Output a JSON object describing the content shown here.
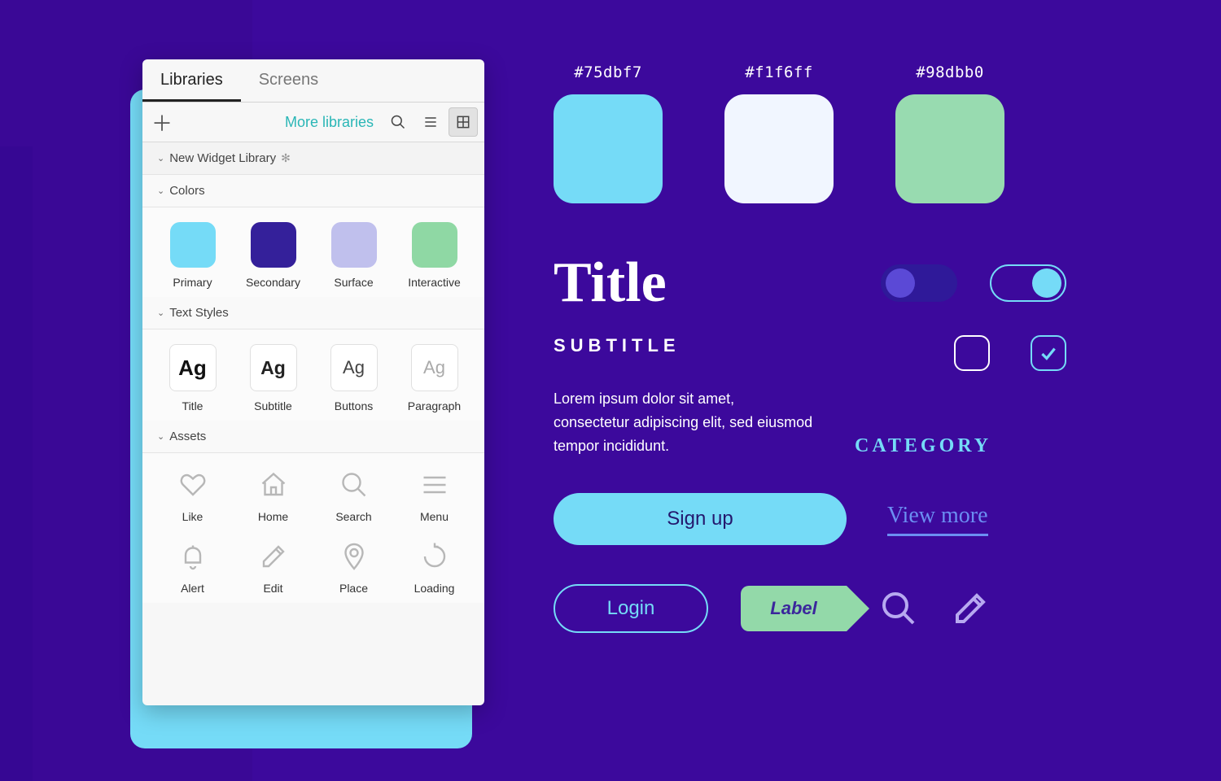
{
  "panel": {
    "tabs": [
      {
        "label": "Libraries",
        "active": true
      },
      {
        "label": "Screens",
        "active": false
      }
    ],
    "more_label": "More libraries",
    "library_name": "New Widget Library",
    "sections": {
      "colors": {
        "title": "Colors",
        "items": [
          {
            "label": "Primary",
            "hex": "#75dbf7"
          },
          {
            "label": "Secondary",
            "hex": "#34209a"
          },
          {
            "label": "Surface",
            "hex": "#c0c0ed"
          },
          {
            "label": "Interactive",
            "hex": "#8fd8a4"
          }
        ]
      },
      "text_styles": {
        "title": "Text Styles",
        "items": [
          {
            "label": "Title",
            "weight": "800",
            "color": "#111",
            "size": "26px"
          },
          {
            "label": "Subtitle",
            "weight": "600",
            "color": "#222",
            "size": "23px"
          },
          {
            "label": "Buttons",
            "weight": "500",
            "color": "#444",
            "size": "22px"
          },
          {
            "label": "Paragraph",
            "weight": "400",
            "color": "#aaa",
            "size": "22px"
          }
        ]
      },
      "assets": {
        "title": "Assets",
        "items": [
          {
            "label": "Like",
            "icon": "heart"
          },
          {
            "label": "Home",
            "icon": "home"
          },
          {
            "label": "Search",
            "icon": "search"
          },
          {
            "label": "Menu",
            "icon": "menu"
          },
          {
            "label": "Alert",
            "icon": "bell"
          },
          {
            "label": "Edit",
            "icon": "pencil"
          },
          {
            "label": "Place",
            "icon": "pin"
          },
          {
            "label": "Loading",
            "icon": "loading"
          }
        ]
      }
    }
  },
  "showcase": {
    "swatches": [
      {
        "hex": "#75dbf7"
      },
      {
        "hex": "#f1f6ff"
      },
      {
        "hex": "#98dbb0"
      }
    ],
    "title": "Title",
    "subtitle": "SUBTITLE",
    "paragraph": "Lorem ipsum dolor sit amet, consectetur adipiscing elit, sed eiusmod tempor incididunt.",
    "category": "CATEGORY",
    "signup": "Sign up",
    "viewmore": "View more",
    "login": "Login",
    "label": "Label"
  }
}
